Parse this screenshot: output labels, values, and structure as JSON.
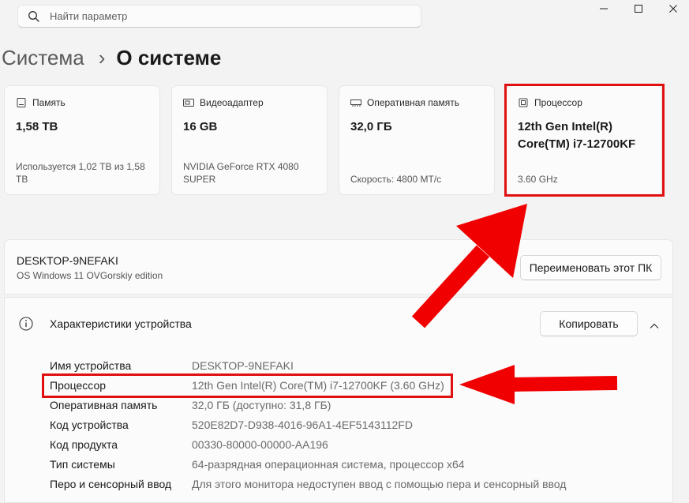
{
  "search": {
    "placeholder": "Найти параметр"
  },
  "breadcrumb": {
    "parent": "Система",
    "separator": "›",
    "current": "О системе"
  },
  "cards": [
    {
      "label": "Память",
      "value": "1,58 ТВ",
      "sub": "Используется 1,02 ТВ из 1,58 ТВ",
      "icon": "storage-icon"
    },
    {
      "label": "Видеоадаптер",
      "value": "16 GB",
      "sub": "NVIDIA GeForce RTX 4080 SUPER",
      "icon": "gpu-icon"
    },
    {
      "label": "Оперативная память",
      "value": "32,0 ГБ",
      "sub": "Скорость: 4800 МТ/с",
      "icon": "ram-icon"
    },
    {
      "label": "Процессор",
      "value": "12th Gen Intel(R) Core(TM) i7-12700KF",
      "sub": "3.60 GHz",
      "icon": "cpu-icon"
    }
  ],
  "device": {
    "name": "DESKTOP-9NEFAKI",
    "edition": "OS Windows 11 OVGorskiy edition",
    "rename_label": "Переименовать этот ПК"
  },
  "specs": {
    "title": "Характеристики устройства",
    "copy_label": "Копировать",
    "rows": [
      {
        "key": "Имя устройства",
        "value": "DESKTOP-9NEFAKI"
      },
      {
        "key": "Процессор",
        "value": "12th Gen Intel(R) Core(TM) i7-12700KF (3.60 GHz)"
      },
      {
        "key": "Оперативная память",
        "value": "32,0 ГБ (доступно: 31,8 ГБ)"
      },
      {
        "key": "Код устройства",
        "value": "520E82D7-D938-4016-96A1-4EF5143112FD"
      },
      {
        "key": "Код продукта",
        "value": "00330-80000-00000-AA196"
      },
      {
        "key": "Тип системы",
        "value": "64-разрядная операционная система, процессор x64"
      },
      {
        "key": "Перо и сенсорный ввод",
        "value": "Для этого монитора недоступен ввод с помощью пера и сенсорный ввод"
      }
    ]
  },
  "colors": {
    "highlight": "#e01010",
    "background": "#f3f3f3",
    "card": "#fbfbfb"
  }
}
